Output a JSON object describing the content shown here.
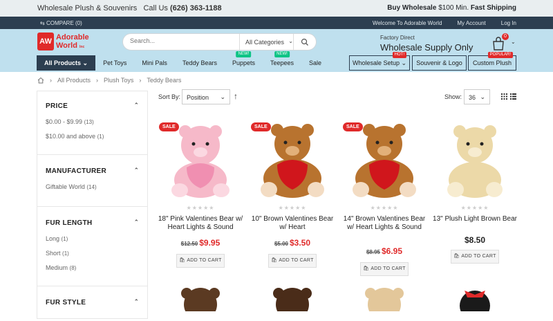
{
  "topbar": {
    "left_text": "Wholesale Plush & Souvenirs",
    "call_label": "Call Us",
    "phone": "(626) 363-1188",
    "buy_wholesale": "Buy Wholesale",
    "min_note": "$100 Min.",
    "fast_shipping": "Fast Shipping"
  },
  "navline": {
    "compare": "COMPARE (0)",
    "links": [
      "Welcome To Adorable World",
      "My Account",
      "Log In"
    ]
  },
  "logo": {
    "line1": "Adorable",
    "line2": "World",
    "mark": "AW",
    "tm": "Inc"
  },
  "search": {
    "placeholder": "Search...",
    "category": "All Categories"
  },
  "factory": {
    "small": "Factory Direct",
    "big": "Wholesale Supply Only"
  },
  "cart": {
    "count": "0"
  },
  "menu": {
    "items": [
      {
        "label": "All Products",
        "active": true
      },
      {
        "label": "Pet Toys"
      },
      {
        "label": "Mini Pals"
      },
      {
        "label": "Teddy Bears"
      },
      {
        "label": "Puppets",
        "badge": "NEW!"
      },
      {
        "label": "Teepees",
        "badge": "NEW!"
      },
      {
        "label": "Sale"
      }
    ],
    "right_buttons": [
      {
        "label": "Wholesale Setup",
        "badge": "HOT!"
      },
      {
        "label": "Souvenir & Logo"
      },
      {
        "label": "Custom Plush",
        "badge": "POPULAR!"
      }
    ]
  },
  "breadcrumb": [
    "All Products",
    "Plush Toys",
    "Teddy Bears"
  ],
  "filters": [
    {
      "title": "PRICE",
      "items": [
        {
          "label": "$0.00 - $9.99",
          "count": "(13)"
        },
        {
          "label": "$10.00 and above",
          "count": "(1)"
        }
      ]
    },
    {
      "title": "MANUFACTURER",
      "items": [
        {
          "label": "Giftable World",
          "count": "(14)"
        }
      ]
    },
    {
      "title": "FUR LENGTH",
      "items": [
        {
          "label": "Long",
          "count": "(1)"
        },
        {
          "label": "Short",
          "count": "(1)"
        },
        {
          "label": "Medium",
          "count": "(8)"
        }
      ]
    },
    {
      "title": "FUR STYLE",
      "items": []
    }
  ],
  "toolbar": {
    "sort_label": "Sort By:",
    "sort_value": "Position",
    "show_label": "Show:",
    "show_value": "36"
  },
  "products": [
    {
      "name": "18\" Pink Valentines Bear w/ Heart Lights & Sound",
      "old_price": "$12.50",
      "price": "$9.95",
      "sale": true,
      "color": "#f6b9c9"
    },
    {
      "name": "10\" Brown Valentines Bear w/ Heart",
      "old_price": "$5.00",
      "price": "$3.50",
      "sale": true,
      "color": "#b8732f"
    },
    {
      "name": "14\" Brown Valentines Bear w/ Heart Lights & Sound",
      "old_price": "$8.95",
      "price": "$6.95",
      "sale": true,
      "color": "#b8732f"
    },
    {
      "name": "13\" Plush Light Brown Bear",
      "old_price": "",
      "price": "$8.50",
      "sale": false,
      "color": "#ecd9a8"
    }
  ],
  "sale_label": "SALE",
  "add_to_cart": "ADD TO CART",
  "stars": "★★★★★",
  "icons": [
    "home-icon",
    "search-icon",
    "cart-icon",
    "grid-icon",
    "list-icon",
    "sort-direction-icon",
    "compare-icon"
  ]
}
